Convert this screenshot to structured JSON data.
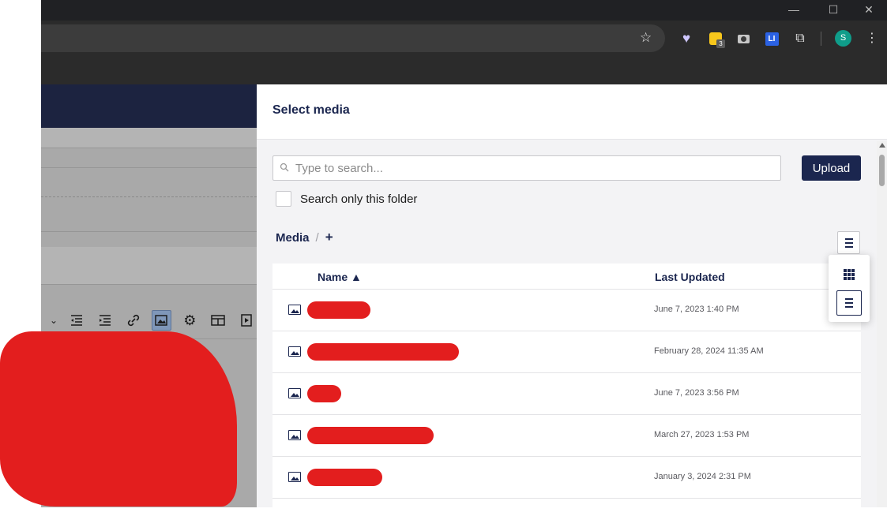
{
  "browser": {
    "window_controls": {
      "minimize": "—",
      "maximize": "☐",
      "close": "✕"
    },
    "bookmark_icon": "star-icon",
    "extensions": {
      "yellow_badge": "3",
      "li_label": "LI"
    },
    "profile_initial": "S",
    "menu_icon": "⋮"
  },
  "background_page": {
    "toolbar_icons": [
      "chevron-down-icon",
      "outdent-icon",
      "indent-icon",
      "link-icon",
      "image-icon",
      "gear-icon",
      "table-icon",
      "media-icon"
    ]
  },
  "dialog": {
    "title": "Select media",
    "search": {
      "placeholder": "Type to search...",
      "value": ""
    },
    "upload_label": "Upload",
    "search_folder_label": "Search only this folder",
    "breadcrumb": {
      "root": "Media",
      "separator": "/",
      "add": "+"
    },
    "columns": {
      "name": "Name ▲",
      "last_updated": "Last Updated"
    },
    "rows": [
      {
        "name": "",
        "date": "June 7, 2023 1:40 PM"
      },
      {
        "name": "",
        "date": "February 28, 2024 11:35 AM"
      },
      {
        "name": "",
        "date": "June 7, 2023 3:56 PM"
      },
      {
        "name": "",
        "date": "March 27, 2023 1:53 PM"
      },
      {
        "name": "",
        "date": "January 3, 2024 2:31 PM"
      }
    ],
    "view_options": [
      "grid-view",
      "list-view"
    ],
    "selected_view": "list-view",
    "accent_color": "#1b264f"
  }
}
